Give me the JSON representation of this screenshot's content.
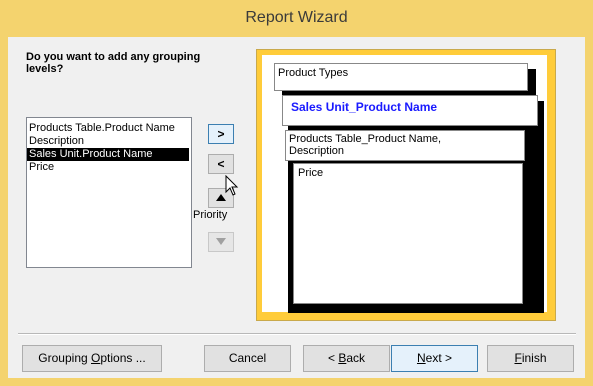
{
  "window": {
    "title": "Report Wizard"
  },
  "question": "Do you want to add any grouping\nlevels?",
  "fields": [
    {
      "label": "Products Table.Product Name",
      "selected": false
    },
    {
      "label": "Description",
      "selected": false
    },
    {
      "label": "Sales Unit.Product Name",
      "selected": true
    },
    {
      "label": "Price",
      "selected": false
    }
  ],
  "controls": {
    "add_label": ">",
    "remove_label": "<",
    "priority_label": "Priority",
    "up_icon": "arrow-up-icon",
    "down_icon": "arrow-down-icon"
  },
  "preview": {
    "group_header": "Product Types",
    "sub_group": "Sales Unit_Product Name",
    "detail_fields": "Products Table_Product Name,\nDescription",
    "last_field": "Price"
  },
  "footer": {
    "grouping_options": {
      "pre": "Grouping ",
      "key": "O",
      "post": "ptions ..."
    },
    "cancel": "Cancel",
    "back": {
      "pre": "< ",
      "key": "B",
      "post": "ack"
    },
    "next": {
      "pre": "",
      "key": "N",
      "post": "ext >"
    },
    "finish": {
      "pre": "",
      "key": "F",
      "post": "inish"
    }
  },
  "colors": {
    "accent": "#f4d36e",
    "preview_frame": "#ffcc3a",
    "sub_group_text": "#1a1aff"
  }
}
